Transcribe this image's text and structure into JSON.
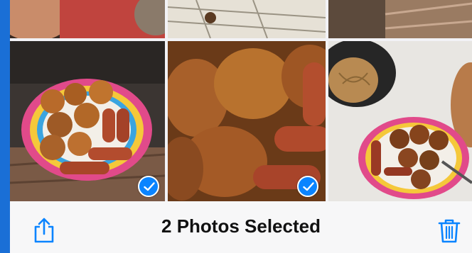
{
  "toolbar": {
    "title": "2 Photos Selected",
    "share_icon": "share-icon",
    "delete_icon": "trash-icon",
    "accent": "#0a84ff"
  },
  "photos": [
    {
      "name": "top-left-person",
      "selected": false
    },
    {
      "name": "top-middle-fabric",
      "selected": false
    },
    {
      "name": "top-right-wood",
      "selected": false
    },
    {
      "name": "chicken-sausage-plate-1",
      "selected": true
    },
    {
      "name": "chicken-sausage-closeup",
      "selected": true
    },
    {
      "name": "noodles-and-plate",
      "selected": false
    }
  ]
}
